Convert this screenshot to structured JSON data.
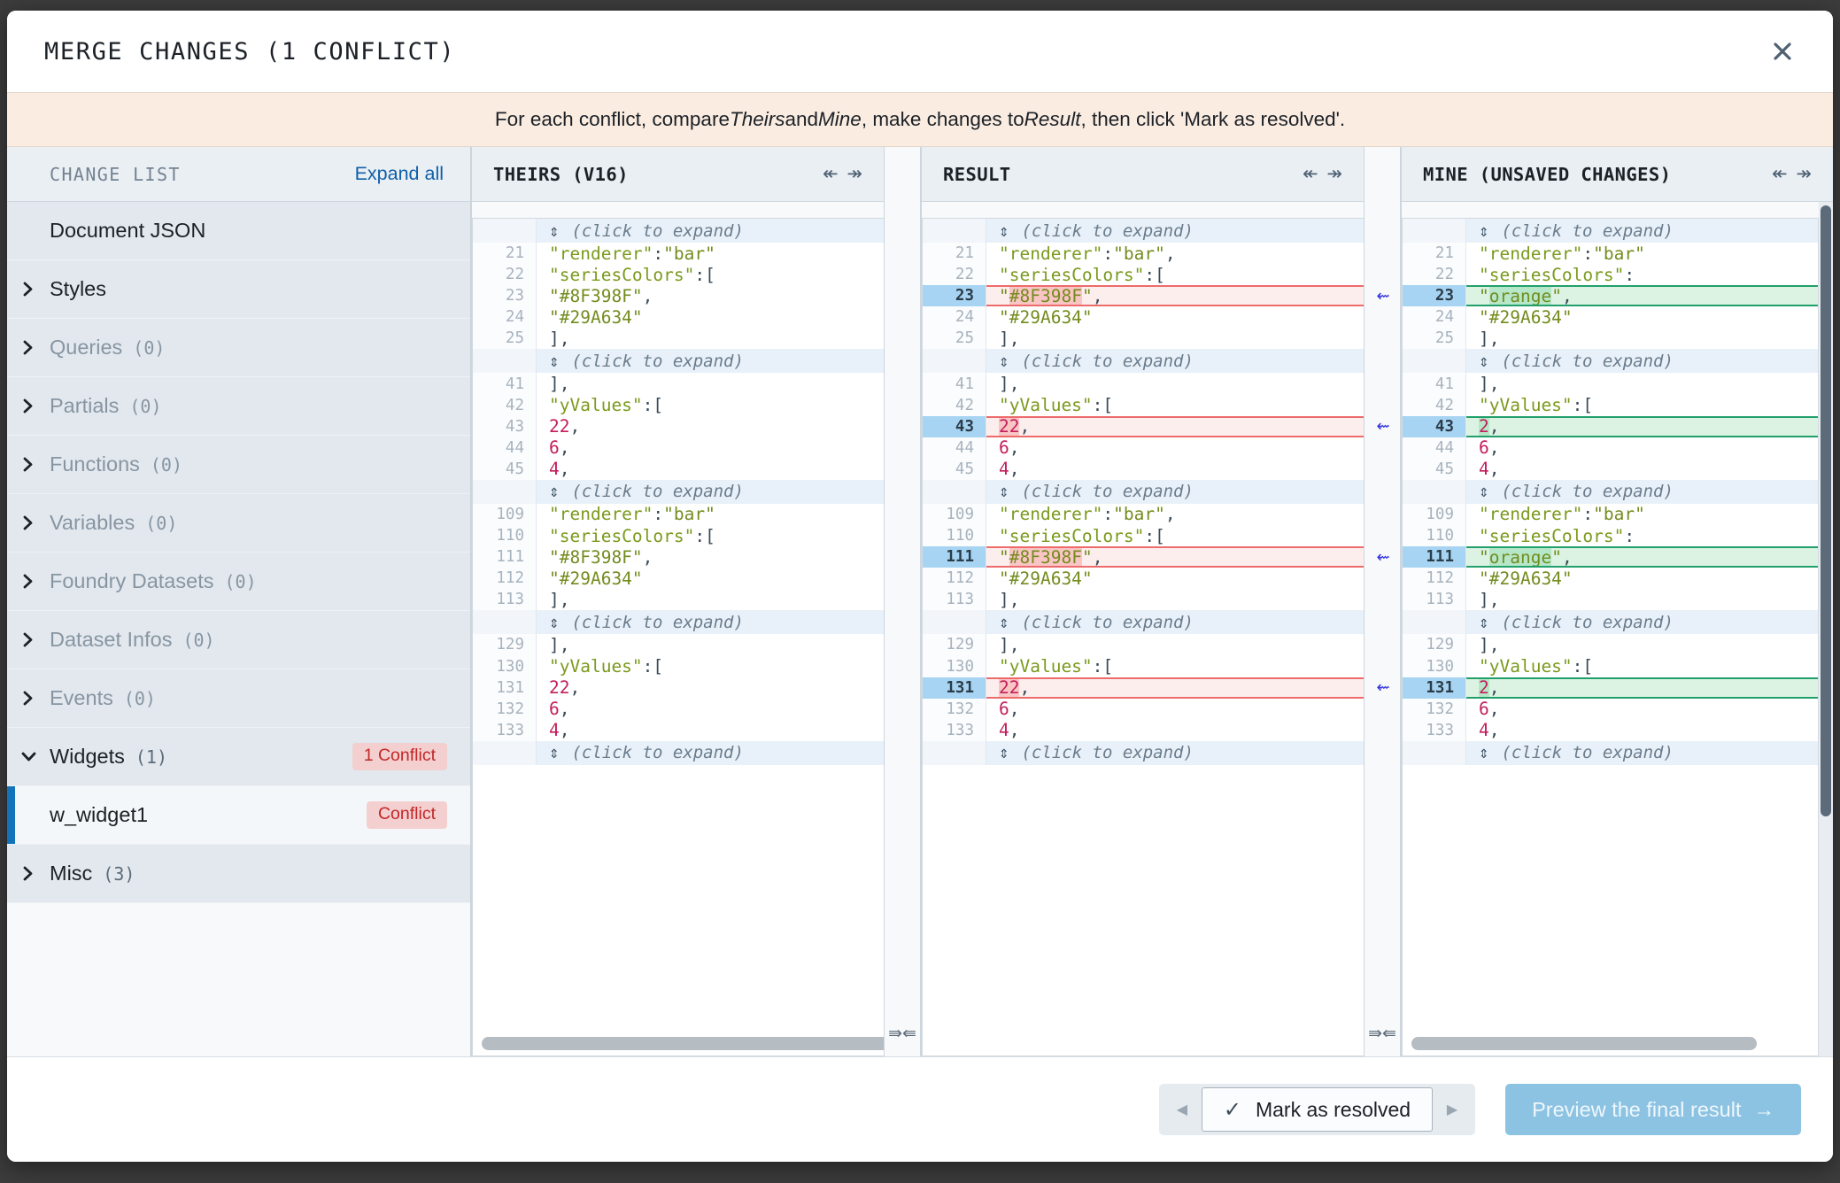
{
  "dialog": {
    "title": "MERGE CHANGES (1 CONFLICT)",
    "close_icon": "close-icon",
    "banner": {
      "part1": "For each conflict, compare ",
      "em1": "Theirs",
      "part2": " and ",
      "em2": "Mine",
      "part3": ", make changes to ",
      "em3": "Result",
      "part4": ", then click 'Mark as resolved'."
    }
  },
  "sidebar": {
    "header_label": "CHANGE LIST",
    "expand_all": "Expand all",
    "items": [
      {
        "label": "Document JSON",
        "count": "",
        "expandable": false,
        "dim": false,
        "badge": ""
      },
      {
        "label": "Styles",
        "count": "",
        "expandable": true,
        "expanded": false,
        "dim": false,
        "badge": ""
      },
      {
        "label": "Queries",
        "count": "(0)",
        "expandable": true,
        "expanded": false,
        "dim": true,
        "badge": ""
      },
      {
        "label": "Partials",
        "count": "(0)",
        "expandable": true,
        "expanded": false,
        "dim": true,
        "badge": ""
      },
      {
        "label": "Functions",
        "count": "(0)",
        "expandable": true,
        "expanded": false,
        "dim": true,
        "badge": ""
      },
      {
        "label": "Variables",
        "count": "(0)",
        "expandable": true,
        "expanded": false,
        "dim": true,
        "badge": ""
      },
      {
        "label": "Foundry Datasets",
        "count": "(0)",
        "expandable": true,
        "expanded": false,
        "dim": true,
        "badge": ""
      },
      {
        "label": "Dataset Infos",
        "count": "(0)",
        "expandable": true,
        "expanded": false,
        "dim": true,
        "badge": ""
      },
      {
        "label": "Events",
        "count": "(0)",
        "expandable": true,
        "expanded": false,
        "dim": true,
        "badge": ""
      },
      {
        "label": "Widgets",
        "count": "(1)",
        "expandable": true,
        "expanded": true,
        "dim": false,
        "badge": "1 Conflict"
      }
    ],
    "selected_child": {
      "label": "w_widget1",
      "badge": "Conflict"
    },
    "trailing_items": [
      {
        "label": "Misc",
        "count": "(3)",
        "expandable": true,
        "expanded": false,
        "dim": false,
        "badge": ""
      }
    ]
  },
  "panes": {
    "theirs": {
      "header": "THEIRS (V16)",
      "arrows": "↞ ↠"
    },
    "result": {
      "header": "RESULT",
      "arrows": "↞ ↠"
    },
    "mine": {
      "header": "MINE (UNSAVED CHANGES)",
      "arrows": "↞ ↠"
    }
  },
  "expand_row_label": "(click to expand)",
  "expand_row_glyph": "⇕",
  "merge_arrow_glyph": "⇜",
  "sync_scroll_glyph": "⇛⇚",
  "code": {
    "theirs": [
      {
        "type": "expand"
      },
      {
        "n": "21",
        "text": "    \"renderer\": \"bar\""
      },
      {
        "n": "22",
        "text": "    \"seriesColors\": ["
      },
      {
        "n": "23",
        "text": "      \"#8F398F\","
      },
      {
        "n": "24",
        "text": "      \"#29A634\""
      },
      {
        "n": "25",
        "text": "    ],"
      },
      {
        "type": "expand"
      },
      {
        "n": "41",
        "text": "    ],"
      },
      {
        "n": "42",
        "text": "    \"yValues\": ["
      },
      {
        "n": "43",
        "text": "      22,"
      },
      {
        "n": "44",
        "text": "      6,"
      },
      {
        "n": "45",
        "text": "      4,"
      },
      {
        "type": "expand"
      },
      {
        "n": "109",
        "text": "    \"renderer\": \"bar\""
      },
      {
        "n": "110",
        "text": "    \"seriesColors\": ["
      },
      {
        "n": "111",
        "text": "      \"#8F398F\","
      },
      {
        "n": "112",
        "text": "      \"#29A634\""
      },
      {
        "n": "113",
        "text": "    ],"
      },
      {
        "type": "expand"
      },
      {
        "n": "129",
        "text": "    ],"
      },
      {
        "n": "130",
        "text": "    \"yValues\": ["
      },
      {
        "n": "131",
        "text": "      22,"
      },
      {
        "n": "132",
        "text": "      6,"
      },
      {
        "n": "133",
        "text": "      4,"
      },
      {
        "type": "expand"
      }
    ],
    "result": [
      {
        "type": "expand"
      },
      {
        "n": "21",
        "text": "    \"renderer\": \"bar\","
      },
      {
        "n": "22",
        "text": "    \"seriesColors\": ["
      },
      {
        "n": "23",
        "text": "      \"#8F398F\",",
        "conflict": true,
        "ink": "#8F398F"
      },
      {
        "n": "24",
        "text": "      \"#29A634\""
      },
      {
        "n": "25",
        "text": "    ],"
      },
      {
        "type": "expand"
      },
      {
        "n": "41",
        "text": "    ],"
      },
      {
        "n": "42",
        "text": "    \"yValues\": ["
      },
      {
        "n": "43",
        "text": "      22,",
        "conflict": true,
        "ink": "22"
      },
      {
        "n": "44",
        "text": "      6,"
      },
      {
        "n": "45",
        "text": "      4,"
      },
      {
        "type": "expand"
      },
      {
        "n": "109",
        "text": "    \"renderer\": \"bar\","
      },
      {
        "n": "110",
        "text": "    \"seriesColors\": ["
      },
      {
        "n": "111",
        "text": "      \"#8F398F\",",
        "conflict": true,
        "ink": "#8F398F"
      },
      {
        "n": "112",
        "text": "      \"#29A634\""
      },
      {
        "n": "113",
        "text": "    ],"
      },
      {
        "type": "expand"
      },
      {
        "n": "129",
        "text": "    ],"
      },
      {
        "n": "130",
        "text": "    \"yValues\": ["
      },
      {
        "n": "131",
        "text": "      22,",
        "conflict": true,
        "ink": "22"
      },
      {
        "n": "132",
        "text": "      6,"
      },
      {
        "n": "133",
        "text": "      4,"
      },
      {
        "type": "expand"
      }
    ],
    "mine": [
      {
        "type": "expand"
      },
      {
        "n": "21",
        "text": "    \"renderer\": \"bar\""
      },
      {
        "n": "22",
        "text": "    \"seriesColors\":"
      },
      {
        "n": "23",
        "text": "      \"orange\",",
        "added": true,
        "ink": "orange"
      },
      {
        "n": "24",
        "text": "      \"#29A634\""
      },
      {
        "n": "25",
        "text": "    ],"
      },
      {
        "type": "expand"
      },
      {
        "n": "41",
        "text": "    ],"
      },
      {
        "n": "42",
        "text": "    \"yValues\": ["
      },
      {
        "n": "43",
        "text": "      2,",
        "added": true,
        "ink": "2"
      },
      {
        "n": "44",
        "text": "      6,"
      },
      {
        "n": "45",
        "text": "      4,"
      },
      {
        "type": "expand"
      },
      {
        "n": "109",
        "text": "    \"renderer\": \"bar\""
      },
      {
        "n": "110",
        "text": "    \"seriesColors\":"
      },
      {
        "n": "111",
        "text": "      \"orange\",",
        "added": true,
        "ink": "orange"
      },
      {
        "n": "112",
        "text": "      \"#29A634\""
      },
      {
        "n": "113",
        "text": "    ],"
      },
      {
        "type": "expand"
      },
      {
        "n": "129",
        "text": "    ],"
      },
      {
        "n": "130",
        "text": "    \"yValues\": ["
      },
      {
        "n": "131",
        "text": "      2,",
        "added": true,
        "ink": "2"
      },
      {
        "n": "132",
        "text": "      6,"
      },
      {
        "n": "133",
        "text": "      4,"
      },
      {
        "type": "expand"
      }
    ]
  },
  "footer": {
    "prev_label": "◀",
    "next_label": "▶",
    "resolve_label": "Mark as resolved",
    "check_glyph": "✓",
    "preview_label": "Preview the final result",
    "preview_arrow": "→"
  },
  "colors": {
    "accent_blue": "#1273ba",
    "conflict_red": "#c22727",
    "added_green": "#22a06b",
    "banner_bg": "#faece1",
    "primary_btn": "#8dc3e2"
  }
}
